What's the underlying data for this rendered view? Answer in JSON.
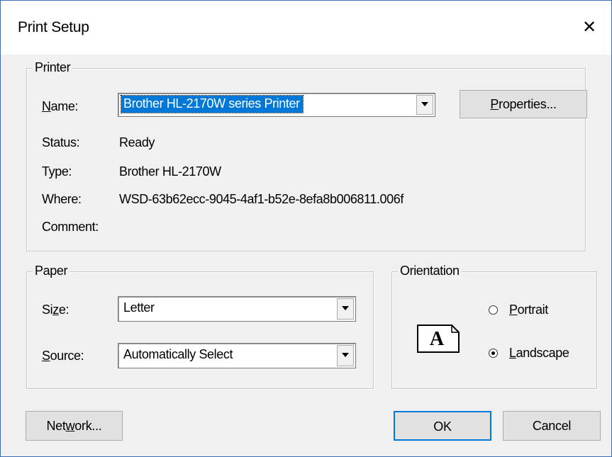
{
  "window": {
    "title": "Print Setup",
    "close_glyph": "✕"
  },
  "printer": {
    "group_label": "Printer",
    "name_label": {
      "pre": "",
      "accel": "N",
      "post": "ame:"
    },
    "name_value": "Brother HL-2170W series Printer",
    "properties_button": {
      "pre": "",
      "accel": "P",
      "post": "roperties..."
    },
    "status_label": "Status:",
    "status_value": "Ready",
    "type_label": "Type:",
    "type_value": "Brother HL-2170W",
    "where_label": "Where:",
    "where_value": "WSD-63b62ecc-9045-4af1-b52e-8efa8b006811.006f",
    "comment_label": "Comment:",
    "comment_value": ""
  },
  "paper": {
    "group_label": "Paper",
    "size_label": {
      "pre": "Si",
      "accel": "z",
      "post": "e:"
    },
    "size_value": "Letter",
    "source_label": {
      "pre": "",
      "accel": "S",
      "post": "ource:"
    },
    "source_value": "Automatically Select"
  },
  "orientation": {
    "group_label": "Orientation",
    "icon_letter": "A",
    "portrait_label": {
      "pre": "",
      "accel": "P",
      "post": "ortrait"
    },
    "portrait_selected": false,
    "landscape_label": {
      "pre": "",
      "accel": "L",
      "post": "andscape"
    },
    "landscape_selected": true
  },
  "buttons": {
    "network": {
      "pre": "Net",
      "accel": "w",
      "post": "ork..."
    },
    "ok": "OK",
    "cancel": "Cancel"
  },
  "colors": {
    "selection": "#0078d7",
    "window_border": "#3c6fb0",
    "dialog_bg": "#f0f0f0",
    "button_bg": "#e1e1e1"
  }
}
